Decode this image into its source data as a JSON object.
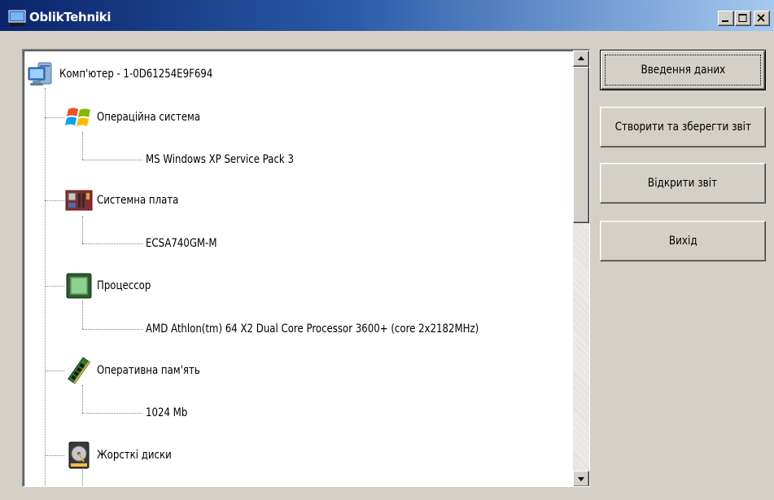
{
  "window": {
    "title": "OblikTehniki",
    "icon": "monitor-icon",
    "controls": [
      "minimize-icon",
      "maximize-icon",
      "close-icon"
    ]
  },
  "tree": {
    "root": {
      "label": "Комп'ютер - 1-0D61254E9F694",
      "icon": "computer-icon"
    },
    "categories": [
      {
        "label": "Операційна система",
        "icon": "windows-logo-icon",
        "value": "MS Windows XP Service Pack 3"
      },
      {
        "label": "Системна плата",
        "icon": "motherboard-icon",
        "value": "ECSA740GM-M"
      },
      {
        "label": "Процессор",
        "icon": "cpu-icon",
        "value": "AMD Athlon(tm) 64 X2 Dual Core Processor 3600+ (core 2x2182MHz)"
      },
      {
        "label": "Оперативна пам'ять",
        "icon": "ram-icon",
        "value": "1024 Mb"
      },
      {
        "label": "Жорсткі диски",
        "icon": "hard-disk-icon",
        "value": ""
      }
    ]
  },
  "buttons": {
    "enter_data": "Введення даних",
    "create_save_report": "Створити та зберегти звіт",
    "open_report": "Відкрити звіт",
    "exit": "Вихід"
  },
  "colors": {
    "titlebar_start": "#0a246a",
    "titlebar_end": "#a6caf0",
    "face": "#d4d0c8"
  }
}
